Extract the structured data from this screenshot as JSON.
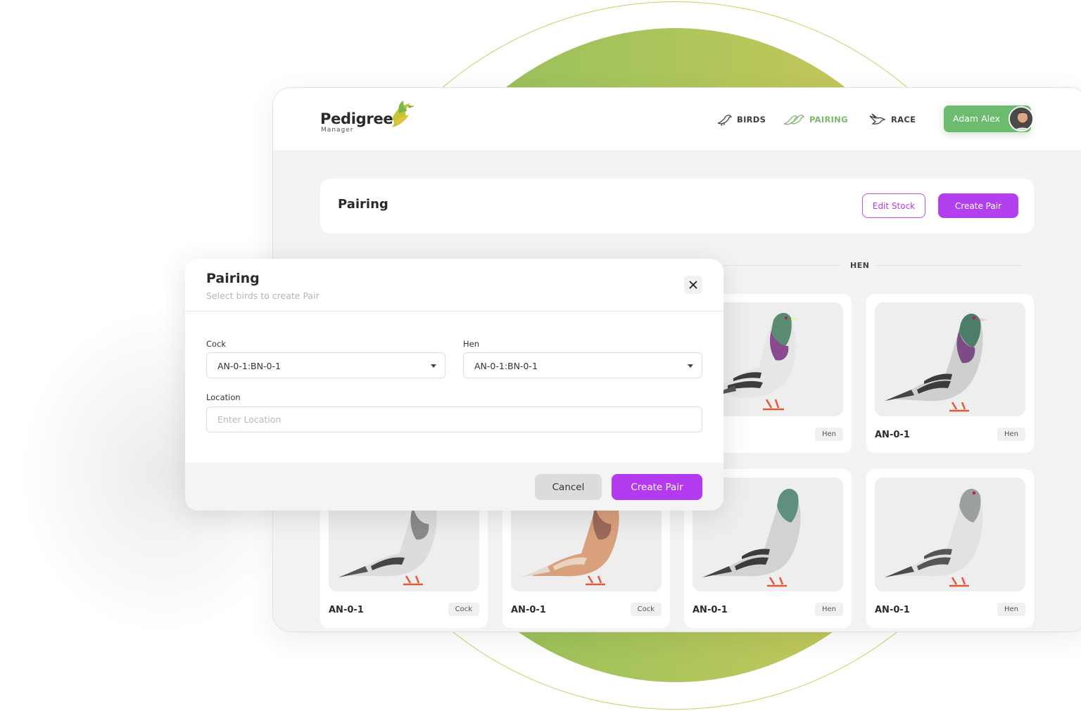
{
  "app": {
    "logo_word": "Pedigree",
    "logo_sub": "Manager"
  },
  "nav": {
    "birds": "BIRDS",
    "pairing": "PAIRING",
    "race": "RACE"
  },
  "user": {
    "name": "Adam Alex"
  },
  "page": {
    "title": "Pairing",
    "edit_stock": "Edit Stock",
    "create_pair": "Create Pair",
    "hen_section": "HEN"
  },
  "birds": [
    {
      "id": "",
      "tag": "Hen",
      "color": "dark"
    },
    {
      "id": "AN-0-1",
      "tag": "Hen",
      "color": "dark"
    },
    {
      "id": "AN-0-1",
      "tag": "Cock",
      "color": "silver"
    },
    {
      "id": "AN-0-1",
      "tag": "Cock",
      "color": "red"
    },
    {
      "id": "AN-0-1",
      "tag": "Hen",
      "color": "light"
    },
    {
      "id": "AN-0-1",
      "tag": "Hen",
      "color": "silver"
    }
  ],
  "modal": {
    "title": "Pairing",
    "subtitle": "Select birds to create Pair",
    "cock_label": "Cock",
    "cock_value": "AN-0-1:BN-0-1",
    "hen_label": "Hen",
    "hen_value": "AN-0-1:BN-0-1",
    "location_label": "Location",
    "location_placeholder": "Enter Location",
    "cancel": "Cancel",
    "create": "Create Pair"
  },
  "colors": {
    "accent_purple": "#b33aee",
    "accent_green": "#6dbb6f"
  }
}
